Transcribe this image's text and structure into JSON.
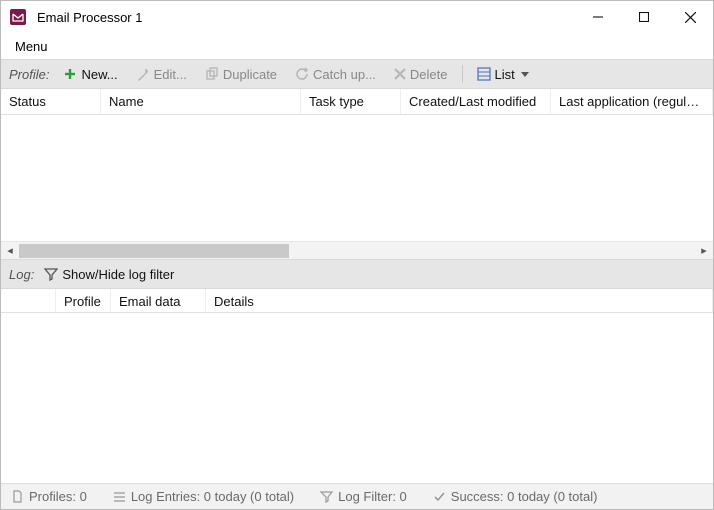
{
  "window": {
    "title": "Email Processor 1"
  },
  "menubar": {
    "main": "Menu"
  },
  "toolbar": {
    "label": "Profile:",
    "new": "New...",
    "edit": "Edit...",
    "duplicate": "Duplicate",
    "catchup": "Catch up...",
    "delete": "Delete",
    "view": "List"
  },
  "profiles_table": {
    "columns": [
      "Status",
      "Name",
      "Task type",
      "Created/Last modified",
      "Last application (regularly)"
    ],
    "rows": []
  },
  "log_toolbar": {
    "label": "Log:",
    "toggle_filter": "Show/Hide log filter"
  },
  "log_table": {
    "columns": [
      "",
      "Profile",
      "Email data",
      "Details"
    ],
    "rows": []
  },
  "statusbar": {
    "profiles": "Profiles: 0",
    "log_entries": "Log Entries: 0 today (0 total)",
    "log_filter": "Log Filter: 0",
    "success": "Success: 0 today (0 total)"
  }
}
